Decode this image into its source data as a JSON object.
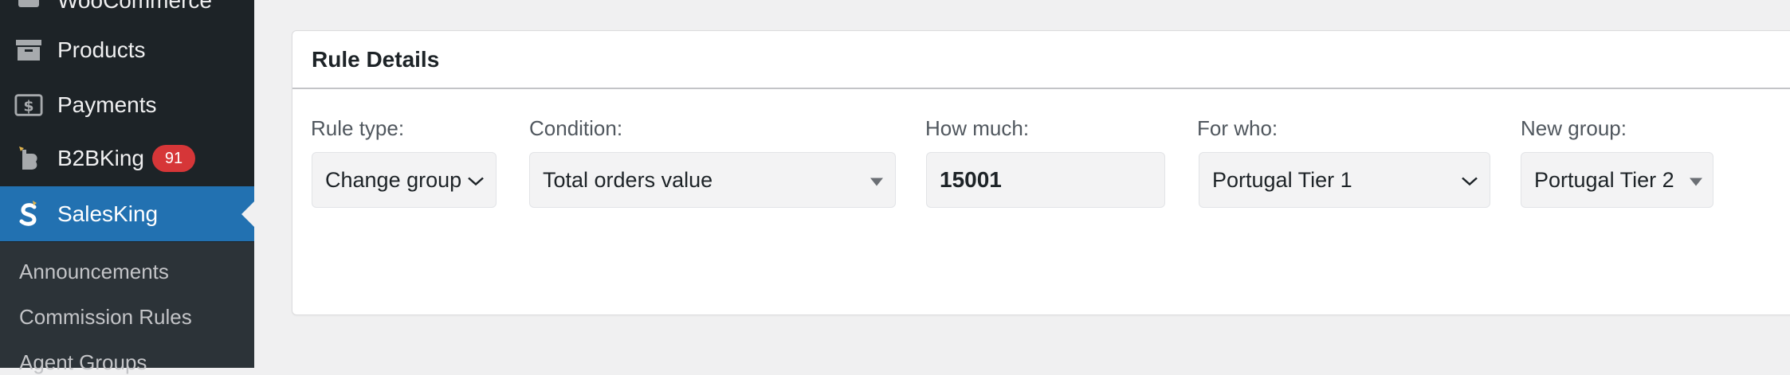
{
  "sidebar": {
    "items": [
      {
        "label": "WooCommerce",
        "icon": "woocommerce-icon"
      },
      {
        "label": "Products",
        "icon": "archive-box-icon"
      },
      {
        "label": "Payments",
        "icon": "dollar-bill-icon"
      },
      {
        "label": "B2BKing",
        "icon": "b2bking-logo-icon",
        "badge": "91"
      },
      {
        "label": "SalesKing",
        "icon": "salesking-logo-icon",
        "active": true
      }
    ],
    "submenu": [
      {
        "label": "Announcements"
      },
      {
        "label": "Commission Rules"
      },
      {
        "label": "Agent Groups"
      }
    ]
  },
  "panel": {
    "title": "Rule Details",
    "fields": [
      {
        "label": "Rule type:",
        "value": "Change group",
        "control": "select-chevron"
      },
      {
        "label": "Condition:",
        "value": "Total orders value",
        "control": "select-triangle"
      },
      {
        "label": "How much:",
        "value": "15001",
        "control": "number-input"
      },
      {
        "label": "For who:",
        "value": "Portugal Tier 1",
        "control": "select-chevron"
      },
      {
        "label": "New group:",
        "value": "Portugal Tier 2",
        "control": "select-triangle"
      }
    ]
  },
  "colors": {
    "sidebar_bg": "#1d2327",
    "submenu_bg": "#2c3338",
    "active_bg": "#2271b1",
    "badge_bg": "#d63638",
    "page_bg": "#f0f0f1"
  }
}
